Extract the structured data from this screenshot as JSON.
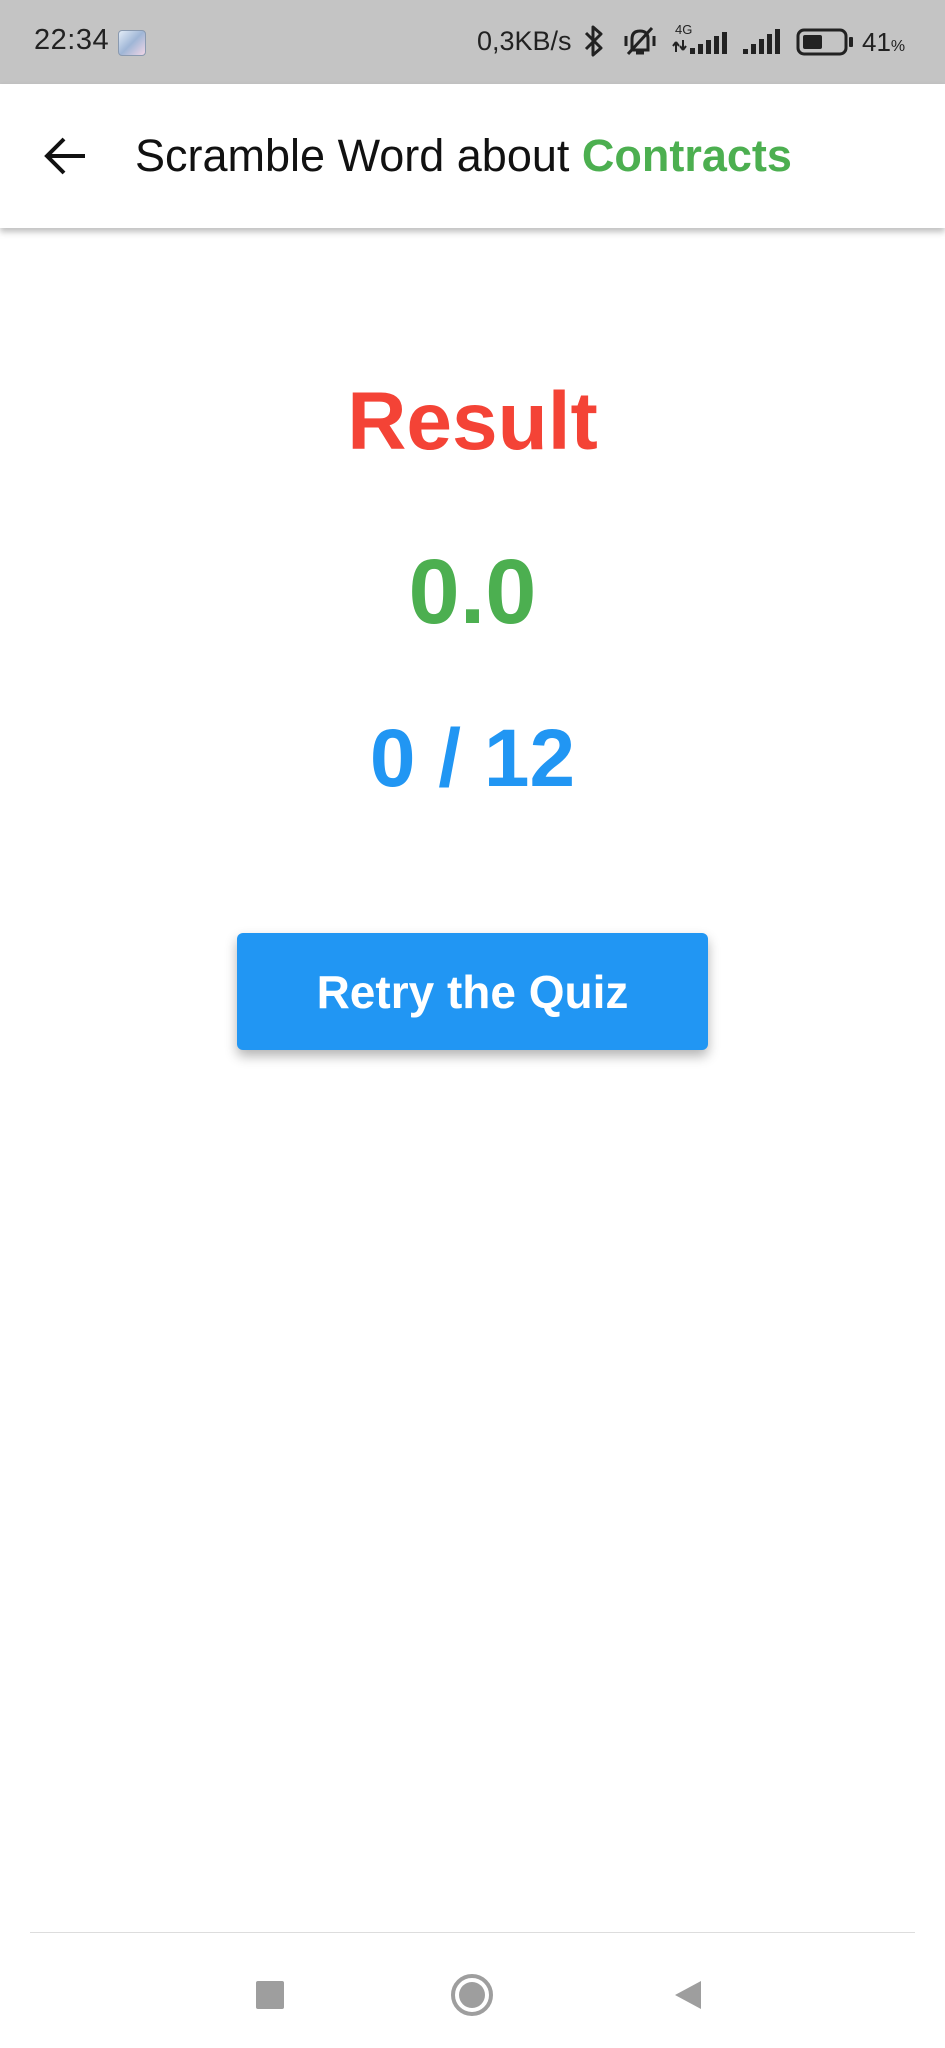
{
  "status_bar": {
    "time": "22:34",
    "notification_icon": "anime-avatar-icon",
    "net_speed": "0,3KB/s",
    "network_type": "4G",
    "battery_percent": "41",
    "battery_unit": "%",
    "icons": [
      "bluetooth-icon",
      "vibrate-off-icon",
      "signal-4g-icon",
      "signal-icon",
      "battery-icon"
    ]
  },
  "app_bar": {
    "back_icon": "arrow-back-icon",
    "title_prefix": "Scramble Word about ",
    "title_topic": "Contracts"
  },
  "result": {
    "heading": "Result",
    "score": "0.0",
    "count": "0 / 12"
  },
  "actions": {
    "retry_label": "Retry the Quiz"
  },
  "nav_bar": {
    "buttons": [
      "recents-icon",
      "home-icon",
      "back-triangle-icon"
    ]
  },
  "colors": {
    "heading": "#f44336",
    "score": "#4caf50",
    "count": "#2196f3",
    "button": "#2196f3",
    "topic": "#4caf50",
    "status_bar": "#c4c4c4"
  }
}
